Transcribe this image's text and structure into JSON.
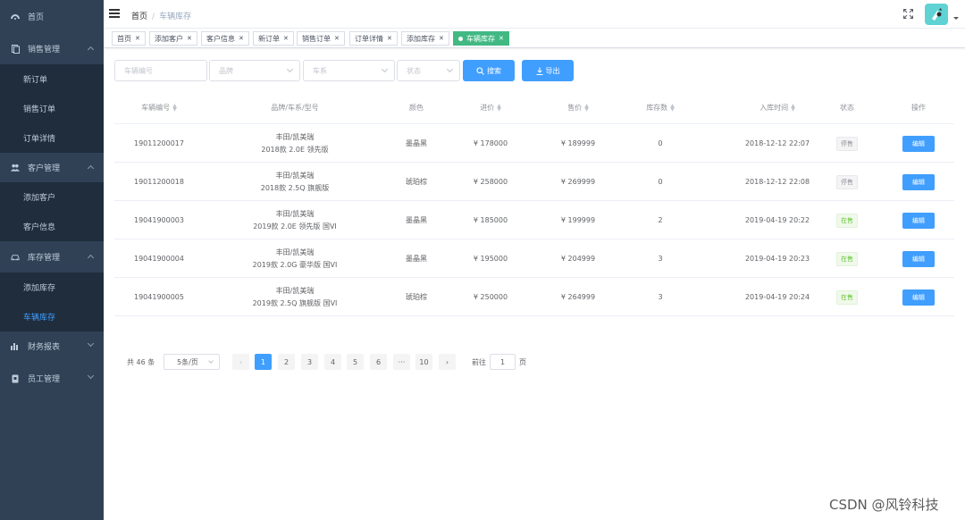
{
  "sidebar": {
    "home": "首页",
    "groups": [
      {
        "label": "销售管理",
        "icon": "document-icon",
        "expanded": true,
        "children": [
          "新订单",
          "销售订单",
          "订单详情"
        ]
      },
      {
        "label": "客户管理",
        "icon": "users-icon",
        "expanded": true,
        "children": [
          "添加客户",
          "客户信息"
        ]
      },
      {
        "label": "库存管理",
        "icon": "car-icon",
        "expanded": true,
        "children": [
          "添加库存",
          "车辆库存"
        ]
      },
      {
        "label": "财务报表",
        "icon": "bar-chart-icon",
        "expanded": false,
        "children": []
      },
      {
        "label": "员工管理",
        "icon": "badge-icon",
        "expanded": false,
        "children": []
      }
    ],
    "active_item": "车辆库存",
    "colors": {
      "bg": "#304156",
      "sub_bg": "#1f2d3d",
      "text": "#bfcbd9",
      "active": "#409eff"
    }
  },
  "navbar": {
    "breadcrumb": [
      "首页",
      "车辆库存"
    ]
  },
  "tags": [
    {
      "label": "首页",
      "active": false
    },
    {
      "label": "添加客户",
      "active": false
    },
    {
      "label": "客户信息",
      "active": false
    },
    {
      "label": "新订单",
      "active": false
    },
    {
      "label": "销售订单",
      "active": false
    },
    {
      "label": "订单详情",
      "active": false
    },
    {
      "label": "添加库存",
      "active": false
    },
    {
      "label": "车辆库存",
      "active": true
    }
  ],
  "filters": {
    "vehicle_no_placeholder": "车辆编号",
    "brand_placeholder": "品牌",
    "series_placeholder": "车系",
    "status_placeholder": "状态",
    "search_label": "搜索",
    "export_label": "导出"
  },
  "table": {
    "headers": [
      "车辆编号",
      "品牌/车系/型号",
      "颜色",
      "进价",
      "售价",
      "库存数",
      "入库时间",
      "状态",
      "操作"
    ],
    "edit_label": "编辑",
    "rows": [
      {
        "id": "19011200017",
        "brand": "丰田/凯美瑞",
        "model": "2018款 2.0E 领先版",
        "color": "墨晶黑",
        "cost": "¥ 178000",
        "price": "¥ 189999",
        "stock": "0",
        "time": "2018-12-12 22:07",
        "status": "停售",
        "on_sale": false
      },
      {
        "id": "19011200018",
        "brand": "丰田/凯美瑞",
        "model": "2018款 2.5Q 旗舰版",
        "color": "琥珀棕",
        "cost": "¥ 258000",
        "price": "¥ 269999",
        "stock": "0",
        "time": "2018-12-12 22:08",
        "status": "停售",
        "on_sale": false
      },
      {
        "id": "19041900003",
        "brand": "丰田/凯美瑞",
        "model": "2019款 2.0E 领先版 国VI",
        "color": "墨晶黑",
        "cost": "¥ 185000",
        "price": "¥ 199999",
        "stock": "2",
        "time": "2019-04-19 20:22",
        "status": "在售",
        "on_sale": true
      },
      {
        "id": "19041900004",
        "brand": "丰田/凯美瑞",
        "model": "2019款 2.0G 豪华版 国VI",
        "color": "墨晶黑",
        "cost": "¥ 195000",
        "price": "¥ 204999",
        "stock": "3",
        "time": "2019-04-19 20:23",
        "status": "在售",
        "on_sale": true
      },
      {
        "id": "19041900005",
        "brand": "丰田/凯美瑞",
        "model": "2019款 2.5Q 旗舰版 国VI",
        "color": "琥珀棕",
        "cost": "¥ 250000",
        "price": "¥ 264999",
        "stock": "3",
        "time": "2019-04-19 20:24",
        "status": "在售",
        "on_sale": true
      }
    ]
  },
  "pagination": {
    "total_label": "共 46 条",
    "page_size": "5条/页",
    "pages": [
      "1",
      "2",
      "3",
      "4",
      "5",
      "6",
      "···",
      "10"
    ],
    "current": "1",
    "prev": "‹",
    "next": "›",
    "goto_label": "前往",
    "goto_value": "1",
    "page_unit": "页"
  },
  "watermark": "CSDN @风铃科技"
}
